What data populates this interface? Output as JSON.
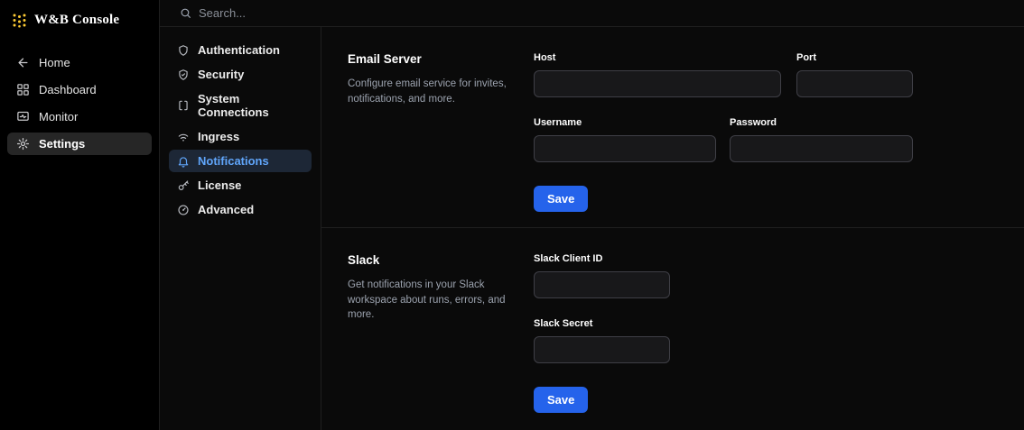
{
  "brand": {
    "title": "W&B Console"
  },
  "search": {
    "placeholder": "Search..."
  },
  "colors": {
    "accent_blue": "#2563eb",
    "active_link_blue": "#60a5fa",
    "logo_gold": "#ffcc33",
    "background": "#0a0a0a",
    "sidebar_background": "#000000"
  },
  "sidebar": {
    "items": [
      {
        "label": "Home",
        "icon": "arrow-left-icon",
        "active": false
      },
      {
        "label": "Dashboard",
        "icon": "grid-icon",
        "active": false
      },
      {
        "label": "Monitor",
        "icon": "monitor-icon",
        "active": false
      },
      {
        "label": "Settings",
        "icon": "gear-icon",
        "active": true
      }
    ]
  },
  "subnav": {
    "items": [
      {
        "label": "Authentication",
        "icon": "shield-icon",
        "active": false
      },
      {
        "label": "Security",
        "icon": "shield-check-icon",
        "active": false
      },
      {
        "label": "System Connections",
        "icon": "brackets-icon",
        "active": false
      },
      {
        "label": "Ingress",
        "icon": "wifi-icon",
        "active": false
      },
      {
        "label": "Notifications",
        "icon": "bell-icon",
        "active": true
      },
      {
        "label": "License",
        "icon": "key-icon",
        "active": false
      },
      {
        "label": "Advanced",
        "icon": "dial-icon",
        "active": false
      }
    ]
  },
  "email_section": {
    "title": "Email Server",
    "description": "Configure email service for invites, notifications, and more.",
    "fields": {
      "host": {
        "label": "Host",
        "value": ""
      },
      "port": {
        "label": "Port",
        "value": ""
      },
      "username": {
        "label": "Username",
        "value": ""
      },
      "password": {
        "label": "Password",
        "value": ""
      }
    },
    "save_label": "Save"
  },
  "slack_section": {
    "title": "Slack",
    "description": "Get notifications in your Slack workspace about runs, errors, and more.",
    "fields": {
      "client_id": {
        "label": "Slack Client ID",
        "value": ""
      },
      "secret": {
        "label": "Slack Secret",
        "value": ""
      }
    },
    "save_label": "Save"
  }
}
